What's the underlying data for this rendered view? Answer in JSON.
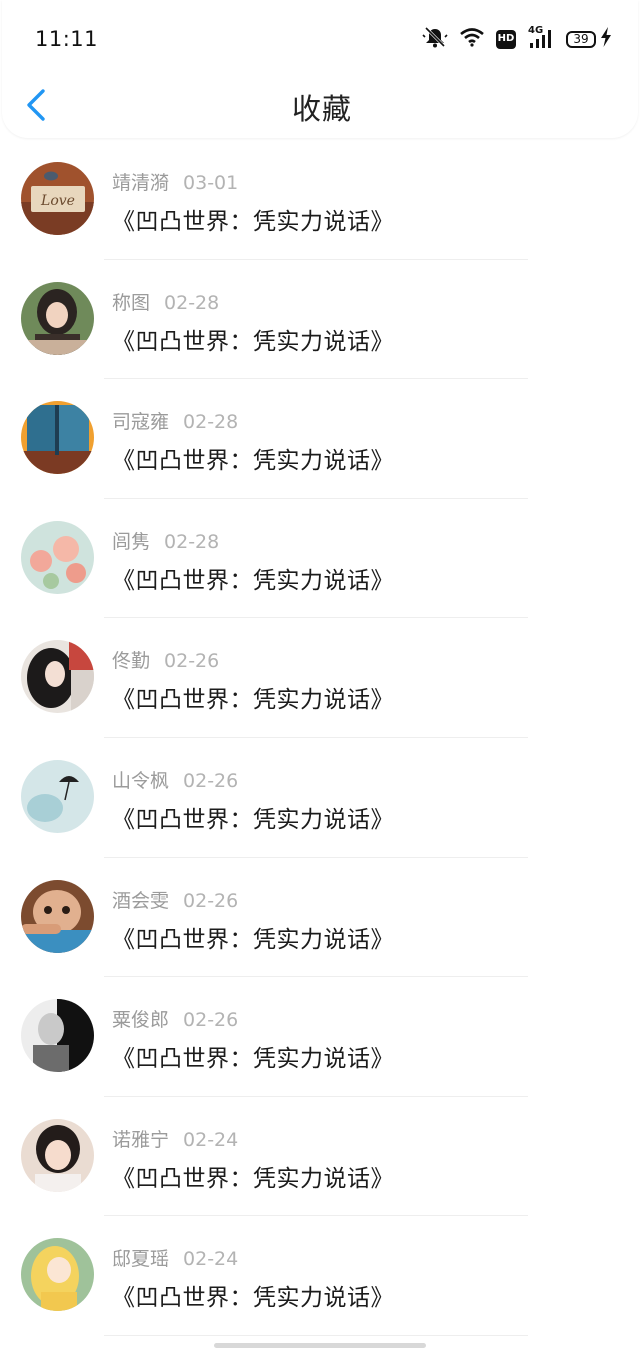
{
  "status_bar": {
    "time": "11:11",
    "network": "4G",
    "hd_label": "HD",
    "battery": "39",
    "icons": [
      "bell-muted-icon",
      "wifi-icon",
      "hd-icon",
      "signal-icon",
      "battery-icon",
      "charging-icon"
    ]
  },
  "header": {
    "title": "收藏",
    "back_icon": "chevron-left-icon",
    "accent_color": "#2196f3"
  },
  "favorites": [
    {
      "name": "靖清漪",
      "date": "03-01",
      "title": "《凹凸世界：凭实力说话》"
    },
    {
      "name": "称图",
      "date": "02-28",
      "title": "《凹凸世界：凭实力说话》"
    },
    {
      "name": "司寇雍",
      "date": "02-28",
      "title": "《凹凸世界：凭实力说话》"
    },
    {
      "name": "闾隽",
      "date": "02-28",
      "title": "《凹凸世界：凭实力说话》"
    },
    {
      "name": "佟勤",
      "date": "02-26",
      "title": "《凹凸世界：凭实力说话》"
    },
    {
      "name": "山令枫",
      "date": "02-26",
      "title": "《凹凸世界：凭实力说话》"
    },
    {
      "name": "酒会雯",
      "date": "02-26",
      "title": "《凹凸世界：凭实力说话》"
    },
    {
      "name": "粟俊郎",
      "date": "02-26",
      "title": "《凹凸世界：凭实力说话》"
    },
    {
      "name": "诺雅宁",
      "date": "02-24",
      "title": "《凹凸世界：凭实力说话》"
    },
    {
      "name": "邸夏瑶",
      "date": "02-24",
      "title": "《凹凸世界：凭实力说话》"
    }
  ],
  "avatar_logo_text": "Love"
}
